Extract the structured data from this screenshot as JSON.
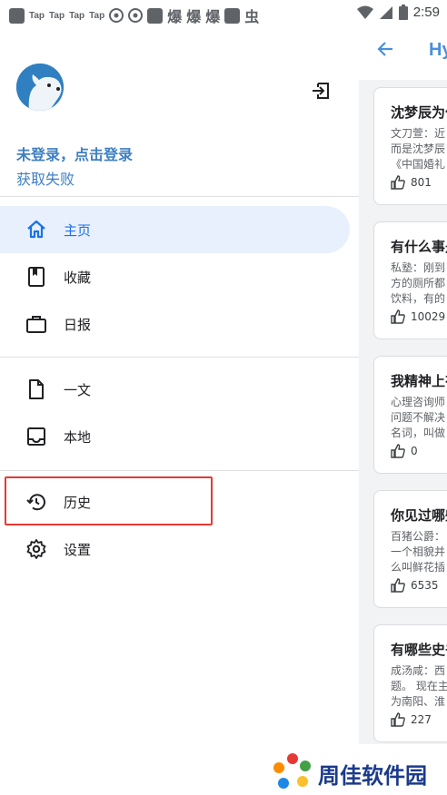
{
  "status_bar": {
    "tap_labels": [
      "Tap",
      "Tap",
      "Tap",
      "Tap"
    ],
    "glyphs": [
      "爆",
      "爆",
      "爆",
      "虫"
    ],
    "time": "2:59"
  },
  "background": {
    "title": "Hy",
    "cards": [
      {
        "title": "沈梦辰为什",
        "body": [
          "文刀萱：近",
          "而是沈梦辰",
          "《中国婚礼"
        ],
        "likes": "801"
      },
      {
        "title": "有什么事是",
        "body": [
          "私塾：刚到",
          "方的厕所都",
          "饮料，有的"
        ],
        "likes": "10029"
      },
      {
        "title": "我精神上有",
        "body": [
          "心理咨询师",
          "问题不解决",
          "名词，叫做"
        ],
        "likes": "0"
      },
      {
        "title": "你见过哪些",
        "body": [
          "百猪公爵：",
          "一个相貌并",
          "么叫鲜花插"
        ],
        "likes": "6535"
      },
      {
        "title": "有哪些史书",
        "body": [
          "成汤咸：西",
          "题。 现在主",
          "为南阳、淮"
        ],
        "likes": "227"
      }
    ]
  },
  "drawer": {
    "login_text": "未登录，点击登录",
    "fail_text": "获取失败",
    "nav": [
      {
        "label": "主页",
        "icon": "home-icon",
        "active": true
      },
      {
        "label": "收藏",
        "icon": "bookmark-icon"
      },
      {
        "label": "日报",
        "icon": "briefcase-icon"
      },
      {
        "label": "一文",
        "icon": "document-icon"
      },
      {
        "label": "本地",
        "icon": "inbox-icon"
      },
      {
        "label": "历史",
        "icon": "history-icon"
      },
      {
        "label": "设置",
        "icon": "settings-icon"
      }
    ]
  },
  "watermark": {
    "text": "周佳软件园"
  },
  "colors": {
    "accent": "#1a73e8",
    "login_blue": "#3f7fc4",
    "active_bg": "#e8f0fe",
    "highlight_red": "#e53935"
  }
}
